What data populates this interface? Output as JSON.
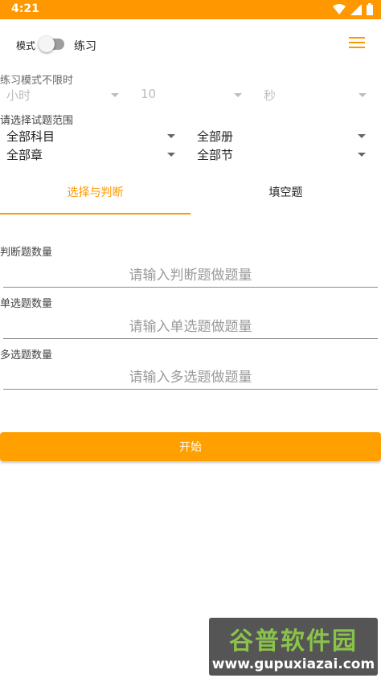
{
  "status_bar": {
    "time": "4:21",
    "icons": [
      "wifi-icon",
      "signal-icon",
      "battery-icon"
    ],
    "color": "#ff9800"
  },
  "header": {
    "mode_label": "模式",
    "switch_on": false,
    "practice_label": "练习",
    "menu_icon": "hamburger-menu-icon"
  },
  "time_limit": {
    "label": "练习模式不限时",
    "hours": "小时",
    "minutes": "10",
    "seconds": "秒"
  },
  "scope": {
    "label": "请选择试题范围",
    "subject": "全部科目",
    "volume": "全部册",
    "chapter": "全部章",
    "section": "全部节"
  },
  "tabs": [
    {
      "label": "选择与判断",
      "active": true
    },
    {
      "label": "填空题",
      "active": false
    }
  ],
  "fields": {
    "judge_label": "判断题数量",
    "judge_placeholder": "请输入判断题做题量",
    "single_label": "单选题数量",
    "single_placeholder": "请输入单选题做题量",
    "multi_label": "多选题数量",
    "multi_placeholder": "请输入多选题做题量"
  },
  "start_button": "开始",
  "accent_color": "#ffa000",
  "watermark": {
    "logo": "谷普软件园",
    "url": "www.gupuxiazai.com"
  }
}
